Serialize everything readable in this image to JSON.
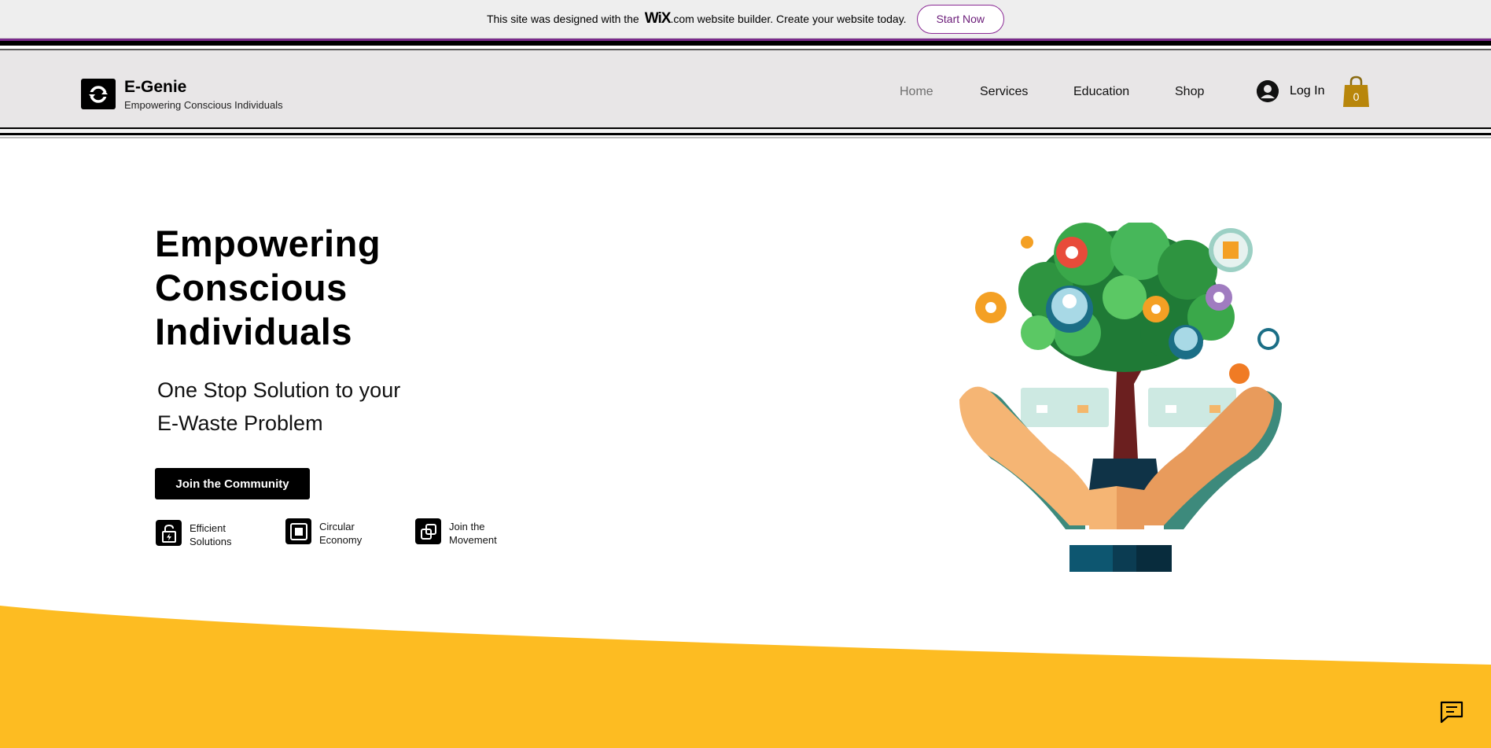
{
  "banner": {
    "text_before": "This site was designed with the",
    "wix_logo": "WiX",
    "text_after": ".com website builder. Create your website today.",
    "cta_label": "Start Now"
  },
  "header": {
    "brand_name": "E-Genie",
    "brand_tagline": "Empowering Conscious Individuals",
    "logo_icon": "refresh-cycle-icon",
    "nav": {
      "home": "Home",
      "services": "Services",
      "education": "Education",
      "shop": "Shop"
    },
    "login_label": "Log In",
    "cart_count": "0"
  },
  "hero": {
    "title_line1": "Empowering",
    "title_line2": "Conscious",
    "title_line3": "Individuals",
    "subtitle_line1": "One Stop Solution to your",
    "subtitle_line2": "E-Waste Problem",
    "cta_label": "Join the Community",
    "features": [
      {
        "line1": "Efficient",
        "line2": "Solutions",
        "icon": "lock-lightning-icon"
      },
      {
        "line1": "Circular",
        "line2": "Economy",
        "icon": "square-frame-icon"
      },
      {
        "line1": "Join the",
        "line2": "Movement",
        "icon": "overlapping-squares-icon"
      }
    ]
  },
  "colors": {
    "accent_yellow": "#FDBC22",
    "banner_purple": "#7A2A8C",
    "header_bg": "#E8E6E7",
    "cart_gold": "#B8860B"
  }
}
